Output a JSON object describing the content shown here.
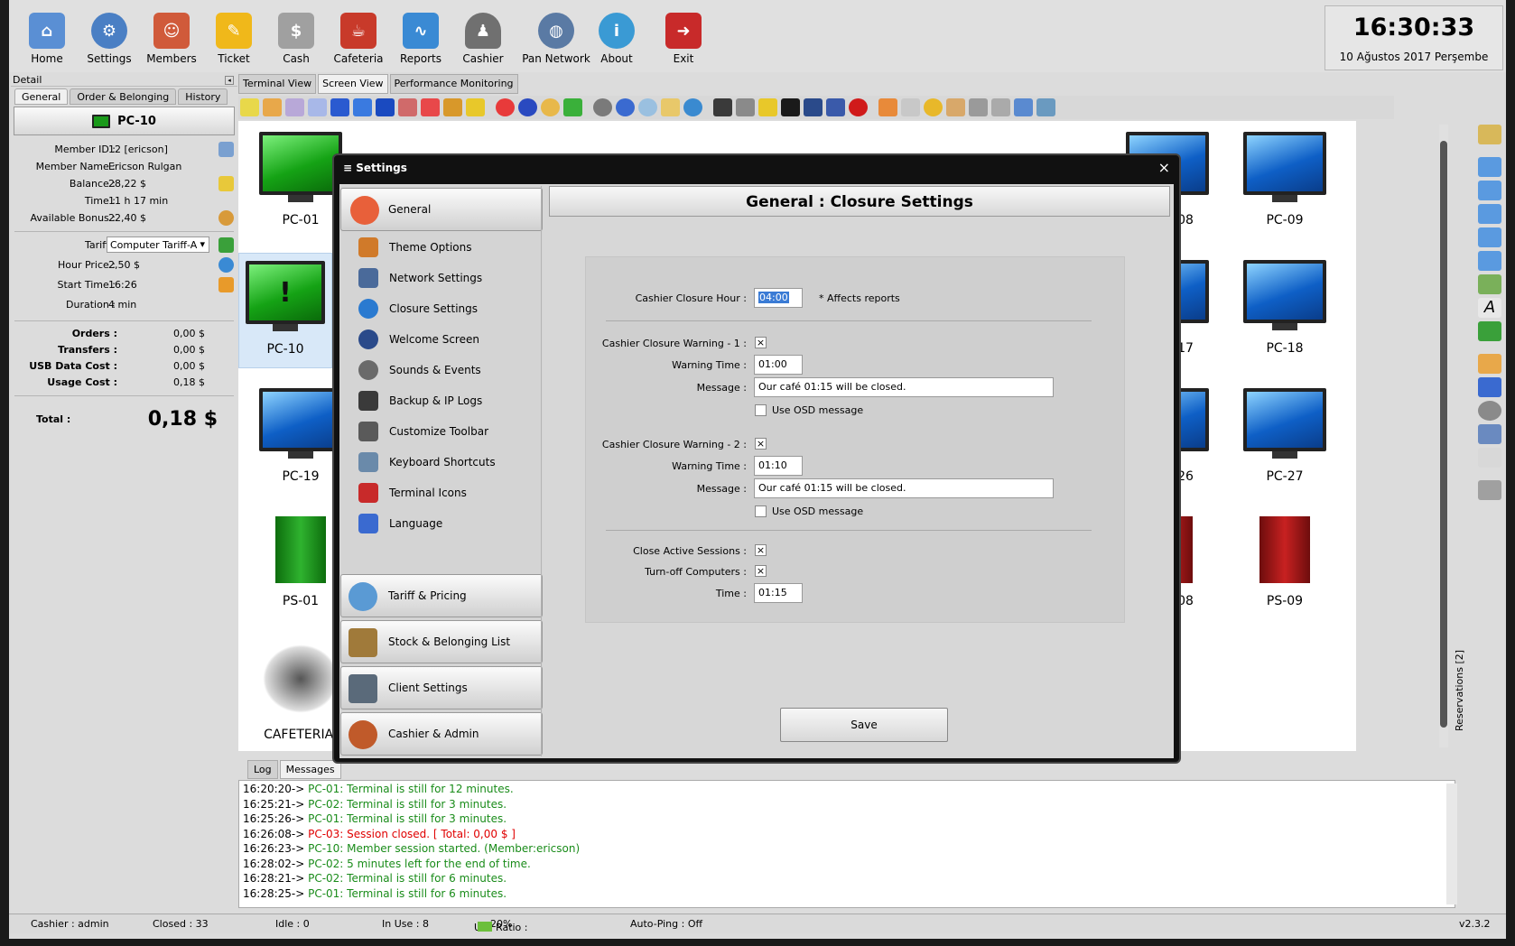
{
  "toolbar": {
    "items": [
      {
        "label": "Home",
        "icon": "home-icon",
        "color": "#5a8fd4"
      },
      {
        "label": "Settings",
        "icon": "gear-icon",
        "color": "#4a7fc4"
      },
      {
        "label": "Members",
        "icon": "members-icon",
        "color": "#d05a3a"
      },
      {
        "label": "Ticket",
        "icon": "ticket-icon",
        "color": "#f0b81a"
      },
      {
        "label": "Cash",
        "icon": "cash-register-icon",
        "color": "#a0a0a0"
      },
      {
        "label": "Cafeteria",
        "icon": "cafeteria-icon",
        "color": "#c83a2a"
      },
      {
        "label": "Reports",
        "icon": "reports-chart-icon",
        "color": "#3a8ad4"
      },
      {
        "label": "Cashier",
        "icon": "cashier-person-icon",
        "color": "#707070"
      },
      {
        "label": "Pan Network",
        "icon": "globe-icon",
        "color": "#5a7aa4"
      },
      {
        "label": "About",
        "icon": "info-icon",
        "color": "#3a9ad4"
      },
      {
        "label": "Exit",
        "icon": "exit-door-icon",
        "color": "#c82a2a"
      }
    ]
  },
  "clock": {
    "time": "16:30:33",
    "date": "10 Ağustos 2017 Perşembe"
  },
  "detail": {
    "title": "Detail",
    "tabs": [
      "General",
      "Order & Belonging",
      "History"
    ],
    "pc_name": "PC-10",
    "rows": [
      {
        "key": "Member ID :",
        "value": "12 [ericson]",
        "icon": "magnifier-icon"
      },
      {
        "key": "Member Name :",
        "value": "Ericson Rulgan",
        "icon": ""
      },
      {
        "key": "Balance :",
        "value": "28,22 $",
        "icon": "coins-icon"
      },
      {
        "key": "Time :",
        "value": "11 h 17 min",
        "icon": ""
      },
      {
        "key": "Available Bonus :",
        "value": "22,40 $",
        "icon": "bonus-badge-icon"
      }
    ],
    "tariff_key": "Tariff :",
    "tariff_value": "Computer Tariff-A",
    "rows2": [
      {
        "key": "Hour Price :",
        "value": "2,50 $",
        "icon": "globe-icon"
      },
      {
        "key": "Start Time :",
        "value": "16:26",
        "icon": "pencil-icon"
      },
      {
        "key": "Duration :",
        "value": "4 min",
        "icon": ""
      }
    ],
    "costs": [
      {
        "key": "Orders :",
        "value": "0,00 $"
      },
      {
        "key": "Transfers :",
        "value": "0,00 $"
      },
      {
        "key": "USB Data Cost :",
        "value": "0,00 $"
      },
      {
        "key": "Usage Cost :",
        "value": "0,18 $"
      }
    ],
    "total_key": "Total :",
    "total_value": "0,18 $"
  },
  "view_tabs": [
    "Terminal View",
    "Screen View",
    "Performance Monitoring"
  ],
  "terminals": [
    {
      "name": "PC-01",
      "kind": "pc-green"
    },
    {
      "name": "PC-09",
      "kind": "pc"
    },
    {
      "name": "PC-10",
      "kind": "pc-alert"
    },
    {
      "name": "PC-18",
      "kind": "pc"
    },
    {
      "name": "PC-19",
      "kind": "pc"
    },
    {
      "name": "PC-27",
      "kind": "pc"
    },
    {
      "name": "PS-01",
      "kind": "ps-green"
    },
    {
      "name": "PS-09",
      "kind": "ps-red"
    },
    {
      "name": "CAFETERIA-",
      "kind": "cafe"
    },
    {
      "name": "08",
      "kind": "pc"
    },
    {
      "name": "17",
      "kind": "pc"
    },
    {
      "name": "26",
      "kind": "pc"
    },
    {
      "name": "08",
      "kind": "ps-red"
    }
  ],
  "reservations_label": "Reservations [2]",
  "settings_dialog": {
    "title": "Settings",
    "close": "×",
    "nav_general": "General",
    "nav_items": [
      {
        "label": "Theme Options",
        "icon": "palette-icon",
        "color": "#d07a2a"
      },
      {
        "label": "Network Settings",
        "icon": "network-icon",
        "color": "#4a6a9a"
      },
      {
        "label": "Closure Settings",
        "icon": "info-icon",
        "color": "#2a7ad0"
      },
      {
        "label": "Welcome Screen",
        "icon": "megaphone-icon",
        "color": "#2a4a8a"
      },
      {
        "label": "Sounds & Events",
        "icon": "speaker-icon",
        "color": "#6a6a6a"
      },
      {
        "label": "Backup & IP Logs",
        "icon": "server-icon",
        "color": "#3a3a3a"
      },
      {
        "label": "Customize Toolbar",
        "icon": "wrench-icon",
        "color": "#5a5a5a"
      },
      {
        "label": "Keyboard Shortcuts",
        "icon": "keyboard-icon",
        "color": "#6a8aaa"
      },
      {
        "label": "Terminal Icons",
        "icon": "ico-file-icon",
        "color": "#c82a2a"
      },
      {
        "label": "Language",
        "icon": "language-icon",
        "color": "#3a6ad0"
      }
    ],
    "nav_groups": [
      {
        "label": "Tariff & Pricing",
        "icon": "clock-calendar-icon",
        "color": "#5a9ad4"
      },
      {
        "label": "Stock & Belonging List",
        "icon": "store-icon",
        "color": "#a07a3a"
      },
      {
        "label": "Client Settings",
        "icon": "monitor-icon",
        "color": "#5a6a7a"
      },
      {
        "label": "Cashier & Admin",
        "icon": "users-icon",
        "color": "#c05a2a"
      }
    ],
    "panel_title": "General : Closure Settings",
    "closure_hour_label": "Cashier Closure Hour :",
    "closure_hour_value": "04:00",
    "affects_note": "* Affects reports",
    "warning1_label": "Cashier Closure Warning - 1 :",
    "warning1_checked": "×",
    "warning_time_label": "Warning Time :",
    "warning1_time": "01:00",
    "message_label": "Message :",
    "warning1_message": "Our café 01:15 will be closed.",
    "use_osd_label": "Use OSD message",
    "warning2_label": "Cashier Closure Warning - 2 :",
    "warning2_checked": "×",
    "warning2_time": "01:10",
    "warning2_message": "Our café 01:15 will be closed.",
    "close_sessions_label": "Close Active Sessions :",
    "close_sessions_checked": "×",
    "turn_off_label": "Turn-off Computers :",
    "turn_off_checked": "×",
    "time_label": "Time :",
    "time_value": "01:15",
    "save_label": "Save"
  },
  "log_tabs": [
    "Log",
    "Messages"
  ],
  "log": [
    {
      "ts": "16:20:20-> ",
      "msg": "PC-01: Terminal is still for 12 minutes.",
      "level": "g"
    },
    {
      "ts": "16:25:21-> ",
      "msg": "PC-02: Terminal is still for 3 minutes.",
      "level": "g"
    },
    {
      "ts": "16:25:26-> ",
      "msg": "PC-01: Terminal is still for 3 minutes.",
      "level": "g"
    },
    {
      "ts": "16:26:08-> ",
      "msg": "PC-03: Session closed. [ Total: 0,00 $ ]",
      "level": "r"
    },
    {
      "ts": "16:26:23-> ",
      "msg": "PC-10: Member session started. (Member:ericson)",
      "level": "g"
    },
    {
      "ts": "16:28:02-> ",
      "msg": "PC-02: 5 minutes left for the end of time.",
      "level": "g"
    },
    {
      "ts": "16:28:21-> ",
      "msg": "PC-02: Terminal is still for 6 minutes.",
      "level": "g"
    },
    {
      "ts": "16:28:25-> ",
      "msg": "PC-01: Terminal is still for 6 minutes.",
      "level": "g"
    }
  ],
  "status": {
    "cashier": "Cashier : admin",
    "closed": "Closed : 33",
    "idle": "Idle : 0",
    "in_use": "In Use : 8",
    "use_ratio_label": "Use Ratio :",
    "use_ratio_value": "20%",
    "auto_ping": "Auto-Ping : Off",
    "version": "v2.3.2"
  }
}
